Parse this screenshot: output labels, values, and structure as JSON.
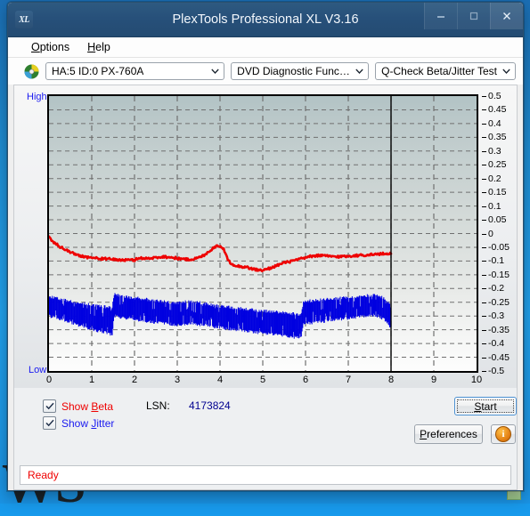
{
  "desktop": {
    "backdrop_text": "WS",
    "background_color": "#1f93e0"
  },
  "window": {
    "title": "PlexTools Professional XL V3.16",
    "app_icon": "XL",
    "icon_name": "xl-logo-icon",
    "buttons": {
      "minimize": "minimize-icon",
      "maximize": "maximize-icon",
      "close": "close-icon"
    }
  },
  "menubar": {
    "items": [
      {
        "label": "Options",
        "mnemonic": "O"
      },
      {
        "label": "Help",
        "mnemonic": "H"
      }
    ]
  },
  "toolbar": {
    "drive_icon": "disc-icon",
    "drive": {
      "value": "HA:5 ID:0  PX-760A"
    },
    "function": {
      "value": "DVD Diagnostic Functions"
    },
    "test": {
      "value": "Q-Check Beta/Jitter Test"
    }
  },
  "graph": {
    "label_high": "High",
    "label_low": "Low"
  },
  "controls": {
    "show_beta": {
      "label": "Show Beta",
      "checked": true,
      "color": "#ef0000"
    },
    "show_jitter": {
      "label": "Show Jitter",
      "checked": true,
      "color": "#1a1af0"
    },
    "lsn_label": "LSN:",
    "lsn_value": "4173824",
    "start_label": "Start",
    "preferences_label": "Preferences",
    "info_label": "i",
    "info_icon": "info-icon"
  },
  "statusbar": {
    "text": "Ready"
  },
  "chart_data": {
    "type": "line",
    "title": "Q-Check Beta/Jitter Test",
    "xlabel": "",
    "ylabel": "",
    "xlim": [
      0,
      10
    ],
    "ylim": [
      -0.5,
      0.5
    ],
    "xticks": [
      0,
      1,
      2,
      3,
      4,
      5,
      6,
      7,
      8,
      9,
      10
    ],
    "yticks": [
      0.5,
      0.45,
      0.4,
      0.35,
      0.3,
      0.25,
      0.2,
      0.15,
      0.1,
      0.05,
      0,
      -0.05,
      -0.1,
      -0.15,
      -0.2,
      -0.25,
      -0.3,
      -0.35,
      -0.4,
      -0.45,
      -0.5
    ],
    "grid": true,
    "grid_style": "dashed",
    "data_end_marker_x": 8,
    "legend": [
      "Show Beta",
      "Show Jitter"
    ],
    "series": [
      {
        "name": "Beta",
        "color": "#ee0000",
        "type": "line",
        "x": [
          0.0,
          0.08,
          0.16,
          0.24,
          0.32,
          0.4,
          0.5,
          0.6,
          0.7,
          0.8,
          0.9,
          1.0,
          1.1,
          1.2,
          1.3,
          1.4,
          1.5,
          1.6,
          1.7,
          1.8,
          1.9,
          2.0,
          2.1,
          2.2,
          2.3,
          2.4,
          2.5,
          2.6,
          2.7,
          2.8,
          2.9,
          3.0,
          3.1,
          3.2,
          3.3,
          3.4,
          3.5,
          3.6,
          3.7,
          3.8,
          3.86,
          3.92,
          3.98,
          4.02,
          4.06,
          4.1,
          4.14,
          4.2,
          4.3,
          4.4,
          4.5,
          4.6,
          4.7,
          4.8,
          4.9,
          5.0,
          5.1,
          5.2,
          5.3,
          5.4,
          5.5,
          5.6,
          5.7,
          5.8,
          5.9,
          6.0,
          6.1,
          6.2,
          6.3,
          6.4,
          6.5,
          6.6,
          6.7,
          6.8,
          6.9,
          7.0,
          7.1,
          7.2,
          7.3,
          7.4,
          7.5,
          7.6,
          7.7,
          7.8,
          7.9,
          8.0
        ],
        "y": [
          -0.015,
          -0.028,
          -0.038,
          -0.046,
          -0.053,
          -0.06,
          -0.068,
          -0.074,
          -0.079,
          -0.083,
          -0.086,
          -0.088,
          -0.09,
          -0.091,
          -0.092,
          -0.093,
          -0.094,
          -0.095,
          -0.096,
          -0.097,
          -0.097,
          -0.096,
          -0.09,
          -0.089,
          -0.09,
          -0.091,
          -0.087,
          -0.085,
          -0.084,
          -0.086,
          -0.088,
          -0.09,
          -0.092,
          -0.094,
          -0.094,
          -0.092,
          -0.088,
          -0.081,
          -0.07,
          -0.058,
          -0.05,
          -0.046,
          -0.044,
          -0.046,
          -0.052,
          -0.062,
          -0.078,
          -0.1,
          -0.112,
          -0.118,
          -0.12,
          -0.122,
          -0.126,
          -0.13,
          -0.133,
          -0.134,
          -0.13,
          -0.124,
          -0.118,
          -0.112,
          -0.107,
          -0.103,
          -0.1,
          -0.096,
          -0.092,
          -0.088,
          -0.084,
          -0.081,
          -0.08,
          -0.081,
          -0.082,
          -0.083,
          -0.084,
          -0.084,
          -0.083,
          -0.082,
          -0.081,
          -0.08,
          -0.079,
          -0.078,
          -0.077,
          -0.076,
          -0.075,
          -0.074,
          -0.073,
          -0.072
        ],
        "note": "Beta value stays between about -0.02 and -0.14 over the whole scan; local peak near x=3.9 and a dip near x=4.9"
      },
      {
        "name": "Jitter",
        "color": "#0000e0",
        "type": "band",
        "x": [
          0.0,
          0.1,
          0.2,
          0.3,
          0.4,
          0.5,
          0.6,
          0.7,
          0.8,
          0.9,
          1.0,
          1.1,
          1.2,
          1.3,
          1.4,
          1.48,
          1.52,
          1.6,
          1.7,
          1.8,
          1.9,
          2.0,
          2.1,
          2.2,
          2.3,
          2.4,
          2.5,
          2.6,
          2.7,
          2.8,
          2.9,
          3.0,
          3.1,
          3.2,
          3.3,
          3.4,
          3.5,
          3.6,
          3.7,
          3.8,
          3.9,
          4.0,
          4.1,
          4.2,
          4.3,
          4.4,
          4.5,
          4.6,
          4.7,
          4.8,
          4.9,
          5.0,
          5.1,
          5.2,
          5.3,
          5.4,
          5.5,
          5.6,
          5.7,
          5.8,
          5.9,
          5.95,
          6.0,
          6.1,
          6.2,
          6.3,
          6.4,
          6.5,
          6.6,
          6.7,
          6.8,
          6.9,
          7.0,
          7.1,
          7.2,
          7.3,
          7.4,
          7.5,
          7.6,
          7.7,
          7.8,
          7.9,
          7.95,
          8.0
        ],
        "y_top": [
          -0.232,
          -0.233,
          -0.236,
          -0.24,
          -0.243,
          -0.247,
          -0.25,
          -0.252,
          -0.255,
          -0.258,
          -0.26,
          -0.262,
          -0.264,
          -0.266,
          -0.268,
          -0.27,
          -0.222,
          -0.224,
          -0.227,
          -0.23,
          -0.232,
          -0.234,
          -0.236,
          -0.238,
          -0.24,
          -0.242,
          -0.244,
          -0.246,
          -0.248,
          -0.25,
          -0.252,
          -0.254,
          -0.25,
          -0.248,
          -0.247,
          -0.249,
          -0.251,
          -0.254,
          -0.257,
          -0.26,
          -0.262,
          -0.264,
          -0.266,
          -0.268,
          -0.27,
          -0.272,
          -0.273,
          -0.275,
          -0.276,
          -0.278,
          -0.28,
          -0.281,
          -0.283,
          -0.284,
          -0.286,
          -0.287,
          -0.289,
          -0.29,
          -0.292,
          -0.293,
          -0.294,
          -0.248,
          -0.246,
          -0.245,
          -0.244,
          -0.243,
          -0.241,
          -0.24,
          -0.238,
          -0.237,
          -0.236,
          -0.234,
          -0.233,
          -0.231,
          -0.23,
          -0.228,
          -0.226,
          -0.225,
          -0.224,
          -0.226,
          -0.232,
          -0.244,
          -0.256,
          -0.268
        ],
        "y_bottom": [
          -0.3,
          -0.304,
          -0.309,
          -0.314,
          -0.319,
          -0.324,
          -0.329,
          -0.334,
          -0.339,
          -0.344,
          -0.348,
          -0.352,
          -0.356,
          -0.36,
          -0.364,
          -0.368,
          -0.3,
          -0.302,
          -0.305,
          -0.308,
          -0.31,
          -0.312,
          -0.315,
          -0.317,
          -0.319,
          -0.321,
          -0.323,
          -0.325,
          -0.327,
          -0.329,
          -0.331,
          -0.333,
          -0.33,
          -0.328,
          -0.327,
          -0.329,
          -0.331,
          -0.333,
          -0.336,
          -0.338,
          -0.34,
          -0.342,
          -0.344,
          -0.346,
          -0.348,
          -0.35,
          -0.352,
          -0.354,
          -0.356,
          -0.358,
          -0.36,
          -0.362,
          -0.364,
          -0.366,
          -0.368,
          -0.37,
          -0.372,
          -0.374,
          -0.376,
          -0.378,
          -0.38,
          -0.33,
          -0.328,
          -0.326,
          -0.324,
          -0.322,
          -0.32,
          -0.318,
          -0.316,
          -0.314,
          -0.312,
          -0.31,
          -0.308,
          -0.306,
          -0.304,
          -0.302,
          -0.3,
          -0.298,
          -0.297,
          -0.3,
          -0.308,
          -0.32,
          -0.334,
          -0.348
        ],
        "note": "Dense jitter noise band roughly spanning -0.22 to -0.38; step discontinuities at x=1.5 and x=5.95, band widens toward the end"
      }
    ]
  }
}
